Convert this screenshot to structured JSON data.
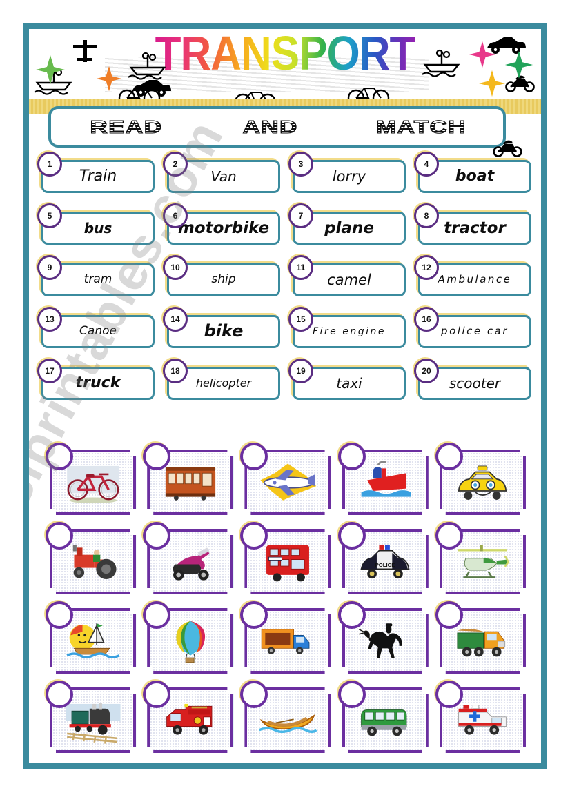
{
  "header": {
    "title": "TRANSPORT",
    "banner_words": [
      "READ",
      "AND",
      "MATCH"
    ],
    "watermark": "eslprintables.com"
  },
  "colors": {
    "frame_teal": "#3b8b9e",
    "word_border": "#3b8b9e",
    "number_purple": "#5a2d82",
    "card_purple": "#6b2fa0",
    "shadow_yellow": "#f2dc8a",
    "card_shadow_blue": "#bfe3ef"
  },
  "words": [
    {
      "n": "1",
      "label": "Train",
      "style": "plain",
      "size": 22
    },
    {
      "n": "2",
      "label": "Van",
      "style": "plain",
      "size": 20
    },
    {
      "n": "3",
      "label": "lorry",
      "style": "plain",
      "size": 21
    },
    {
      "n": "4",
      "label": "boat",
      "style": "bold",
      "size": 22
    },
    {
      "n": "5",
      "label": "bus",
      "style": "bold",
      "size": 20
    },
    {
      "n": "6",
      "label": "motorbike",
      "style": "bold",
      "size": 23
    },
    {
      "n": "7",
      "label": "plane",
      "style": "bold",
      "size": 23
    },
    {
      "n": "8",
      "label": "tractor",
      "style": "bold",
      "size": 23
    },
    {
      "n": "9",
      "label": "tram",
      "style": "plain",
      "size": 17
    },
    {
      "n": "10",
      "label": "ship",
      "style": "plain",
      "size": 17
    },
    {
      "n": "11",
      "label": "camel",
      "style": "plain",
      "size": 21
    },
    {
      "n": "12",
      "label": "Ambulance",
      "style": "spaced",
      "size": 15
    },
    {
      "n": "13",
      "label": "Canoe",
      "style": "plain",
      "size": 17
    },
    {
      "n": "14",
      "label": "bike",
      "style": "bold",
      "size": 24
    },
    {
      "n": "15",
      "label": "Fire engine",
      "style": "spaced",
      "size": 14
    },
    {
      "n": "16",
      "label": "police car",
      "style": "spaced",
      "size": 15
    },
    {
      "n": "17",
      "label": "truck",
      "style": "bold",
      "size": 22
    },
    {
      "n": "18",
      "label": "helicopter",
      "style": "plain",
      "size": 16
    },
    {
      "n": "19",
      "label": "taxi",
      "style": "plain",
      "size": 20
    },
    {
      "n": "20",
      "label": "scooter",
      "style": "plain",
      "size": 20
    }
  ],
  "pictures": [
    {
      "id": "bicycle",
      "name": "bicycle-picture"
    },
    {
      "id": "tram",
      "name": "tram-picture"
    },
    {
      "id": "plane",
      "name": "plane-picture"
    },
    {
      "id": "ship",
      "name": "ship-picture"
    },
    {
      "id": "taxi",
      "name": "taxi-picture"
    },
    {
      "id": "tractor",
      "name": "tractor-picture"
    },
    {
      "id": "scooter",
      "name": "scooter-picture"
    },
    {
      "id": "bus",
      "name": "bus-picture"
    },
    {
      "id": "police-car",
      "name": "police-car-picture"
    },
    {
      "id": "helicopter",
      "name": "helicopter-picture"
    },
    {
      "id": "boat",
      "name": "sailboat-picture"
    },
    {
      "id": "balloon",
      "name": "hot-air-balloon-picture"
    },
    {
      "id": "van",
      "name": "van-picture"
    },
    {
      "id": "camel",
      "name": "camel-picture"
    },
    {
      "id": "lorry",
      "name": "lorry-picture"
    },
    {
      "id": "train",
      "name": "train-picture"
    },
    {
      "id": "fire-engine",
      "name": "fire-engine-picture"
    },
    {
      "id": "canoe",
      "name": "canoe-picture"
    },
    {
      "id": "minibus",
      "name": "minibus-picture"
    },
    {
      "id": "ambulance",
      "name": "ambulance-picture"
    }
  ],
  "header_clipart": [
    {
      "id": "plane",
      "name": "plane-icon"
    },
    {
      "id": "boat",
      "name": "boat-icon"
    },
    {
      "id": "boat",
      "name": "boat-icon"
    },
    {
      "id": "boat",
      "name": "boat-icon"
    },
    {
      "id": "car",
      "name": "car-icon"
    },
    {
      "id": "car",
      "name": "car-icon"
    },
    {
      "id": "bicycle",
      "name": "bicycle-icon"
    },
    {
      "id": "bicycle",
      "name": "bicycle-icon"
    },
    {
      "id": "bicycle",
      "name": "bicycle-icon"
    },
    {
      "id": "motorbike",
      "name": "motorbike-icon"
    },
    {
      "id": "motorbike",
      "name": "motorbike-icon"
    },
    {
      "id": "star",
      "name": "star-icon"
    }
  ]
}
